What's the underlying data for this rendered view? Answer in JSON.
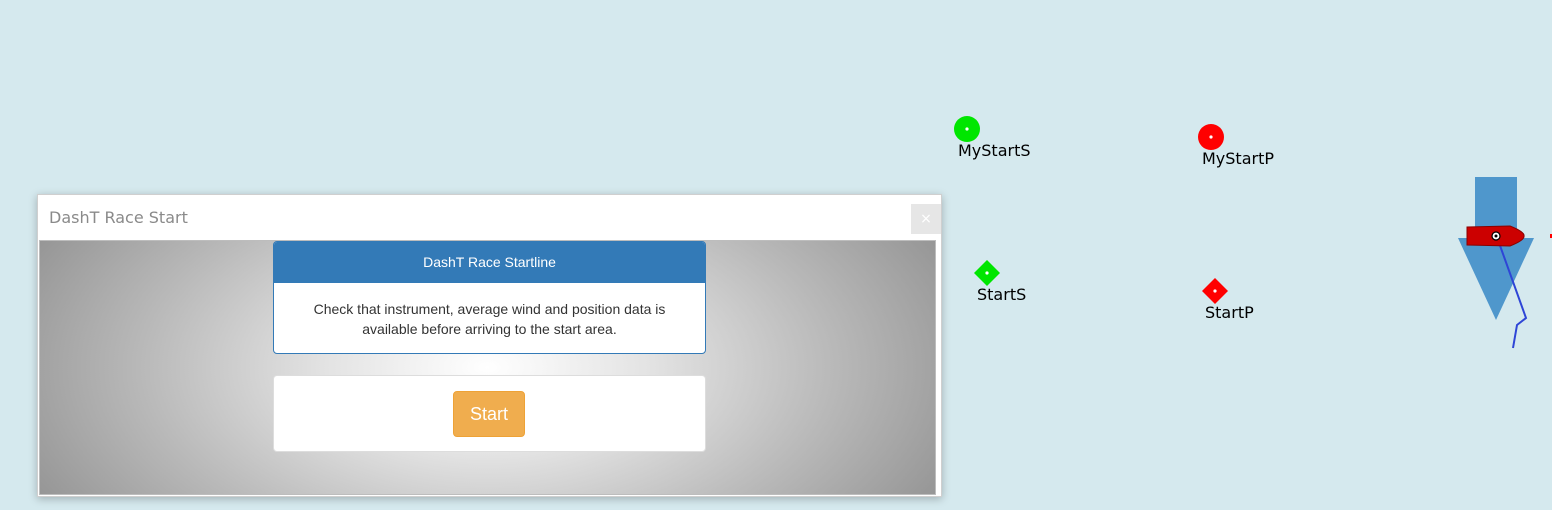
{
  "marks": {
    "my_start_s": {
      "label": "MyStartS",
      "color": "#00e600"
    },
    "my_start_p": {
      "label": "MyStartP",
      "color": "#ff0000"
    },
    "start_s": {
      "label": "StartS",
      "color": "#00e600"
    },
    "start_p": {
      "label": "StartP",
      "color": "#ff0000"
    }
  },
  "boat": {
    "hull_color": "#cc0000",
    "wind_arrow_color": "#4f97cc",
    "track_color": "#2e45d6"
  },
  "dialog": {
    "title": "DashT Race Start",
    "close_label": "×",
    "info_card": {
      "header": "DashT Race Startline",
      "text": "Check that instrument, average wind and position data is available before arriving to the start area."
    },
    "start_button_label": "Start",
    "accent_color": "#337ab7",
    "button_color": "#f0ad4e"
  }
}
